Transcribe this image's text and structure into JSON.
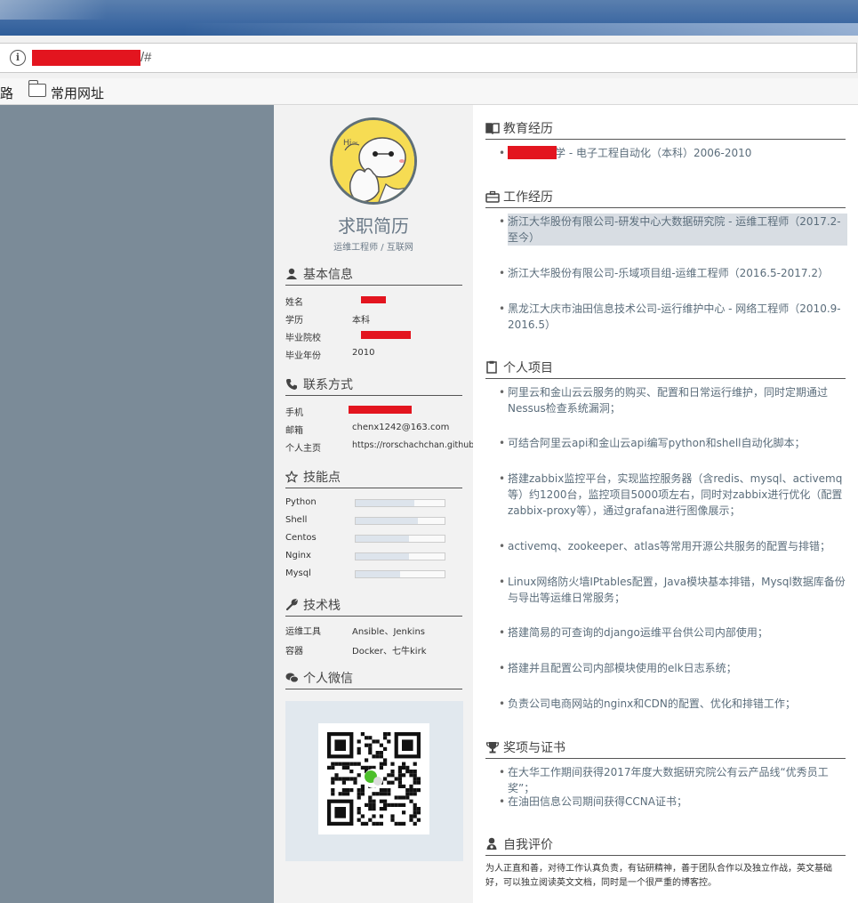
{
  "browser": {
    "url_suffix": "/#",
    "bookmarks": [
      {
        "label": "路"
      },
      {
        "label": "常用网址"
      }
    ]
  },
  "sidebar": {
    "name": "求职简历",
    "subtitle": "运维工程师 / 互联网",
    "basic": {
      "title": "基本信息",
      "rows": [
        {
          "key": "姓名",
          "value": ""
        },
        {
          "key": "学历",
          "value": "本科"
        },
        {
          "key": "毕业院校",
          "value": ""
        },
        {
          "key": "毕业年份",
          "value": "2010"
        }
      ]
    },
    "contact": {
      "title": "联系方式",
      "rows": [
        {
          "key": "手机",
          "value": ""
        },
        {
          "key": "邮箱",
          "value": "chenx1242@163.com"
        },
        {
          "key": "个人主页",
          "value": "https://rorschachchan.github.io"
        }
      ]
    },
    "skills": {
      "title": "技能点",
      "items": [
        {
          "name": "Python",
          "level": 0.66
        },
        {
          "name": "Shell",
          "level": 0.7
        },
        {
          "name": "Centos",
          "level": 0.6
        },
        {
          "name": "Nginx",
          "level": 0.6
        },
        {
          "name": "Mysql",
          "level": 0.5
        }
      ]
    },
    "stack": {
      "title": "技术栈",
      "rows": [
        {
          "key": "运维工具",
          "value": "Ansible、Jenkins"
        },
        {
          "key": "容器",
          "value": "Docker、七牛kirk"
        }
      ]
    },
    "wechat": {
      "title": "个人微信"
    }
  },
  "main": {
    "education": {
      "title": "教育经历",
      "items": [
        "学 - 电子工程自动化（本科）2006-2010"
      ]
    },
    "work": {
      "title": "工作经历",
      "items": [
        "浙江大华股份有限公司-研发中心大数据研究院 - 运维工程师（2017.2-至今）",
        "浙江大华股份有限公司-乐域项目组-运维工程师（2016.5-2017.2）",
        "黑龙江大庆市油田信息技术公司-运行维护中心 - 网络工程师（2010.9-2016.5）"
      ]
    },
    "projects": {
      "title": "个人项目",
      "items": [
        "阿里云和金山云云服务的购买、配置和日常运行维护，同时定期通过Nessus检查系统漏洞；",
        "可结合阿里云api和金山云api编写python和shell自动化脚本；",
        "搭建zabbix监控平台，实现监控服务器（含redis、mysql、activemq等）约1200台，监控项目5000项左右，同时对zabbix进行优化（配置zabbix-proxy等），通过grafana进行图像展示；",
        "activemq、zookeeper、atlas等常用开源公共服务的配置与排错；",
        "Linux网络防火墙IPtables配置，Java模块基本排错，Mysql数据库备份与导出等运维日常服务；",
        "搭建简易的可查询的django运维平台供公司内部使用；",
        "搭建并且配置公司内部模块使用的elk日志系统；",
        "负责公司电商网站的nginx和CDN的配置、优化和排错工作；"
      ]
    },
    "awards": {
      "title": "奖项与证书",
      "items": [
        "在大华工作期间获得2017年度大数据研究院公有云产品线“优秀员工奖”；",
        "在油田信息公司期间获得CCNA证书；"
      ]
    },
    "self": {
      "title": "自我评价",
      "text": "为人正直和善，对待工作认真负责，有钻研精神，善于团队合作以及独立作战，英文基础好，可以独立阅读英文文档，同时是一个很严重的博客控。"
    }
  }
}
